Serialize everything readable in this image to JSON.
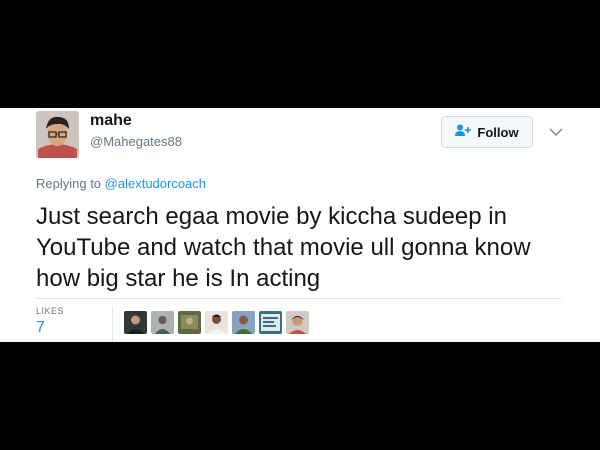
{
  "tweet": {
    "display_name": "mahe",
    "handle": "@Mahegates88",
    "follow_label": "Follow",
    "replying_prefix": "Replying to ",
    "replying_to": "@alextudorcoach",
    "text": "Just search egaa movie by kiccha sudeep in YouTube and watch that movie ull gonna know how big star he is In acting",
    "likes_label": "LIKES",
    "likes_count": "7"
  },
  "colors": {
    "link": "#1b95e0",
    "text": "#14171a",
    "muted": "#657786",
    "letterbox": "#000000"
  },
  "icons": {
    "follow": "person-plus-icon",
    "menu": "chevron-down-icon"
  },
  "likers_count": 7
}
